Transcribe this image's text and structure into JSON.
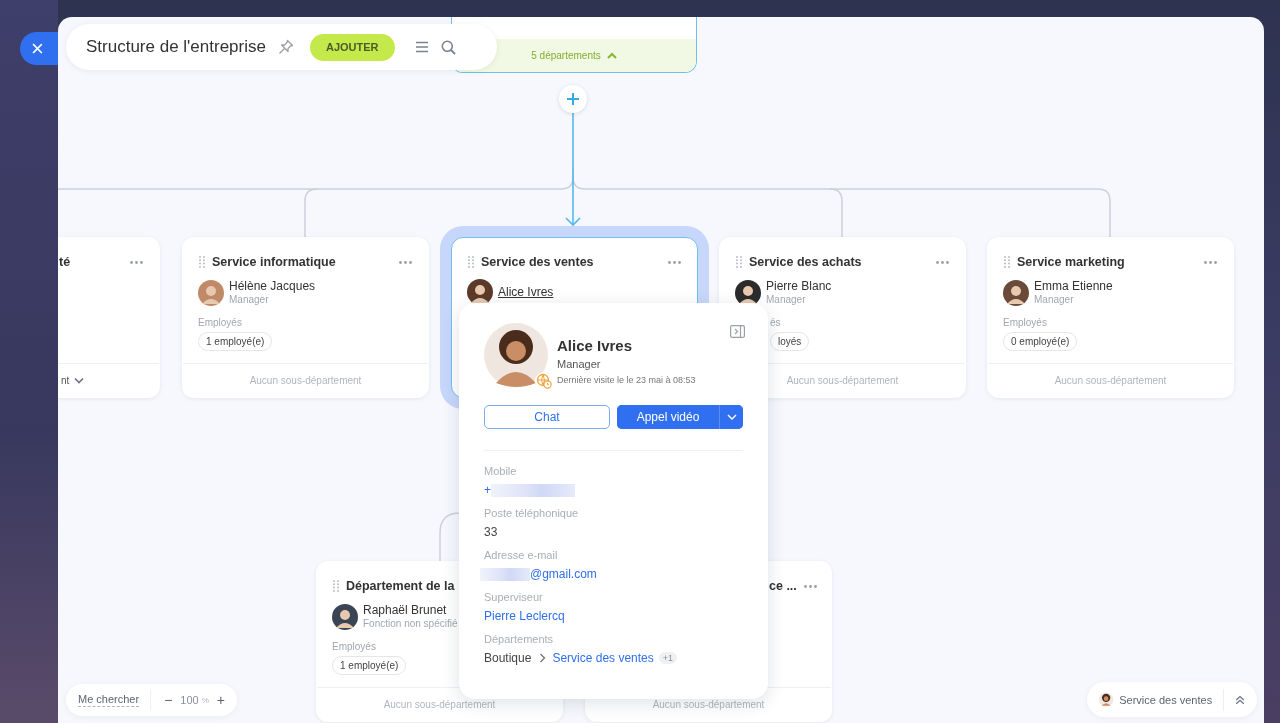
{
  "header": {
    "close_icon": "×",
    "title": "Structure de l'entreprise",
    "add_button": "AJOUTER"
  },
  "root_department": {
    "footer": "5 départements",
    "expanded": true
  },
  "departments": [
    {
      "title": "té",
      "selected": false,
      "footer": {
        "kind": "toggle",
        "text": "nt",
        "expanded": false
      }
    },
    {
      "title": "Service informatique",
      "selected": false,
      "manager": {
        "name": "Hélène Jacques",
        "role": "Manager"
      },
      "employees_label": "Employés",
      "employees": "1 employé(e)",
      "footer": {
        "kind": "empty",
        "text": "Aucun sous-département"
      }
    },
    {
      "title": "Service des ventes",
      "selected": true,
      "manager": {
        "name": "Alice Ivres"
      }
    },
    {
      "title": "Service des achats",
      "selected": false,
      "manager": {
        "name": "Pierre Blanc",
        "role": "Manager"
      },
      "employees_label": "és",
      "employees": "loyés",
      "footer": {
        "kind": "empty",
        "text": "Aucun sous-département"
      }
    },
    {
      "title": "Service marketing",
      "selected": false,
      "manager": {
        "name": "Emma Etienne",
        "role": "Manager"
      },
      "employees_label": "Employés",
      "employees": "0 employé(e)",
      "footer": {
        "kind": "empty",
        "text": "Aucun sous-département"
      }
    },
    {
      "title": "Département de la",
      "selected": false,
      "manager": {
        "name": "Raphaël Brunet",
        "role": "Fonction non spécifié"
      },
      "employees_label": "Employés",
      "employees": "1 employé(e)",
      "footer": {
        "kind": "empty",
        "text": "Aucun sous-département"
      }
    },
    {
      "title": "ce ...",
      "selected": false,
      "footer": {
        "kind": "empty",
        "text": "Aucun sous-département"
      }
    }
  ],
  "profile_popup": {
    "name": "Alice Ivres",
    "role": "Manager",
    "last_visit": "Dernière visite le le 23 mai à 08:53",
    "chat_button": "Chat",
    "call_button": "Appel vidéo",
    "fields": [
      {
        "kind": "phone",
        "label": "Mobile",
        "value": "+"
      },
      {
        "kind": "text",
        "label": "Poste téléphonique",
        "value": "33"
      },
      {
        "kind": "email",
        "label": "Adresse e-mail",
        "value": "@gmail.com"
      },
      {
        "kind": "link",
        "label": "Superviseur",
        "value": "Pierre Leclercq"
      },
      {
        "kind": "path",
        "label": "Départements",
        "parent": "Boutique",
        "value": "Service des ventes",
        "extra": "+1"
      }
    ]
  },
  "zoom_bar": {
    "find_me": "Me chercher",
    "minus": "−",
    "value": "100",
    "unit": "%",
    "plus": "+"
  },
  "current_department": {
    "label": "Service des ventes"
  }
}
